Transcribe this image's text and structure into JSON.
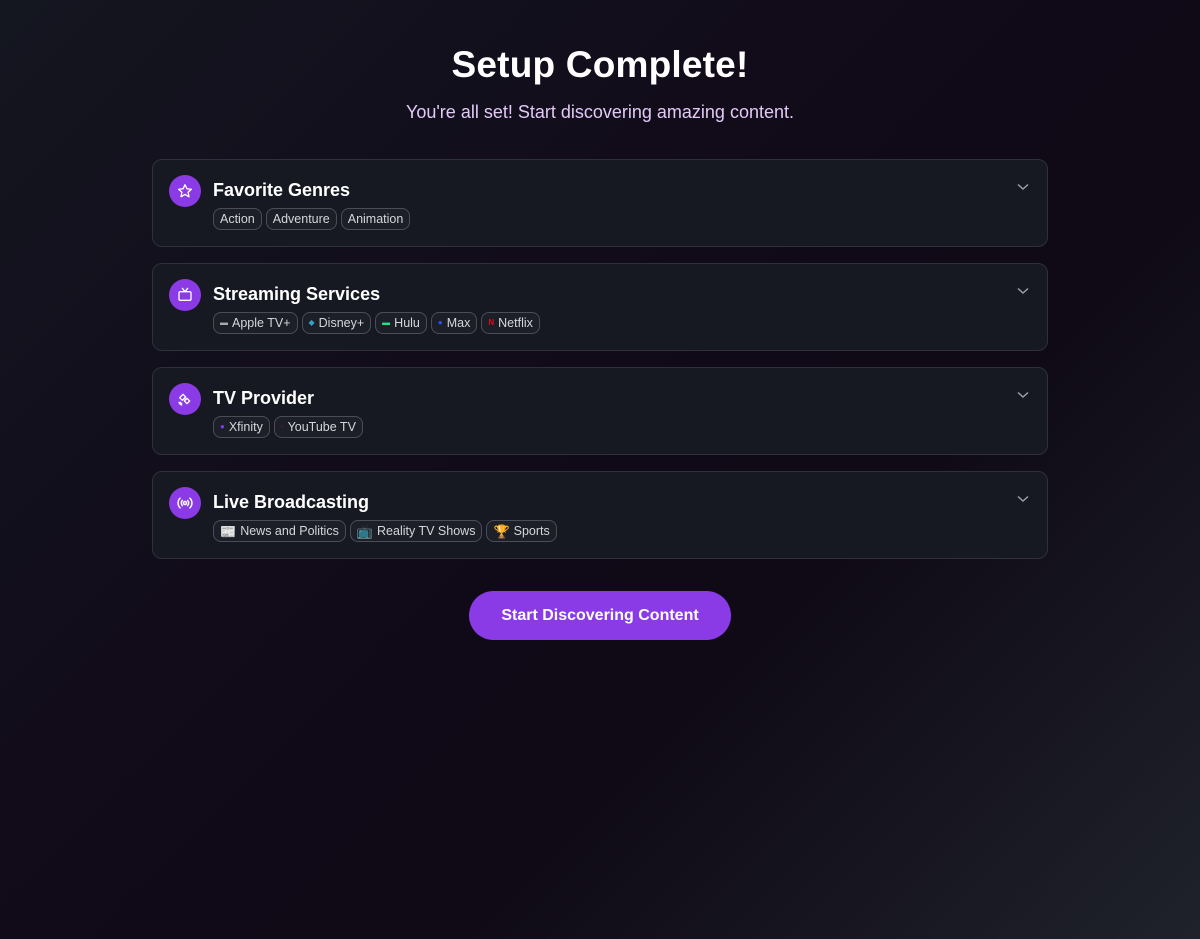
{
  "header": {
    "title": "Setup Complete!",
    "subtitle": "You're all set! Start discovering amazing content."
  },
  "sections": [
    {
      "title": "Favorite Genres",
      "icon": "star-icon",
      "items": [
        {
          "label": "Action"
        },
        {
          "label": "Adventure"
        },
        {
          "label": "Animation"
        }
      ]
    },
    {
      "title": "Streaming Services",
      "icon": "tv-icon",
      "items": [
        {
          "label": "Apple TV+",
          "logo": "apple-tv-logo",
          "logo_color": "#aaaaaa"
        },
        {
          "label": "Disney+",
          "logo": "disney-logo",
          "logo_color": "#2fa3c4"
        },
        {
          "label": "Hulu",
          "logo": "hulu-logo",
          "logo_color": "#1ce783"
        },
        {
          "label": "Max",
          "logo": "max-logo",
          "logo_color": "#2b4cff"
        },
        {
          "label": "Netflix",
          "logo": "netflix-logo",
          "logo_color": "#e50914"
        }
      ]
    },
    {
      "title": "TV Provider",
      "icon": "satellite-icon",
      "items": [
        {
          "label": "Xfinity",
          "logo": "xfinity-logo",
          "logo_color": "#7c3aed"
        },
        {
          "label": "YouTube TV",
          "logo": "youtube-tv-logo",
          "logo_color": "#ff0000"
        }
      ]
    },
    {
      "title": "Live Broadcasting",
      "icon": "broadcast-icon",
      "items": [
        {
          "label": "News and Politics",
          "emoji": "📰"
        },
        {
          "label": "Reality TV Shows",
          "emoji": "📺"
        },
        {
          "label": "Sports",
          "emoji": "🏆"
        }
      ]
    }
  ],
  "cta": {
    "label": "Start Discovering Content"
  },
  "colors": {
    "accent": "#8a3be5",
    "subtitle": "#e2c9f6",
    "card_bg": "#171922",
    "card_border": "#2e313b"
  }
}
